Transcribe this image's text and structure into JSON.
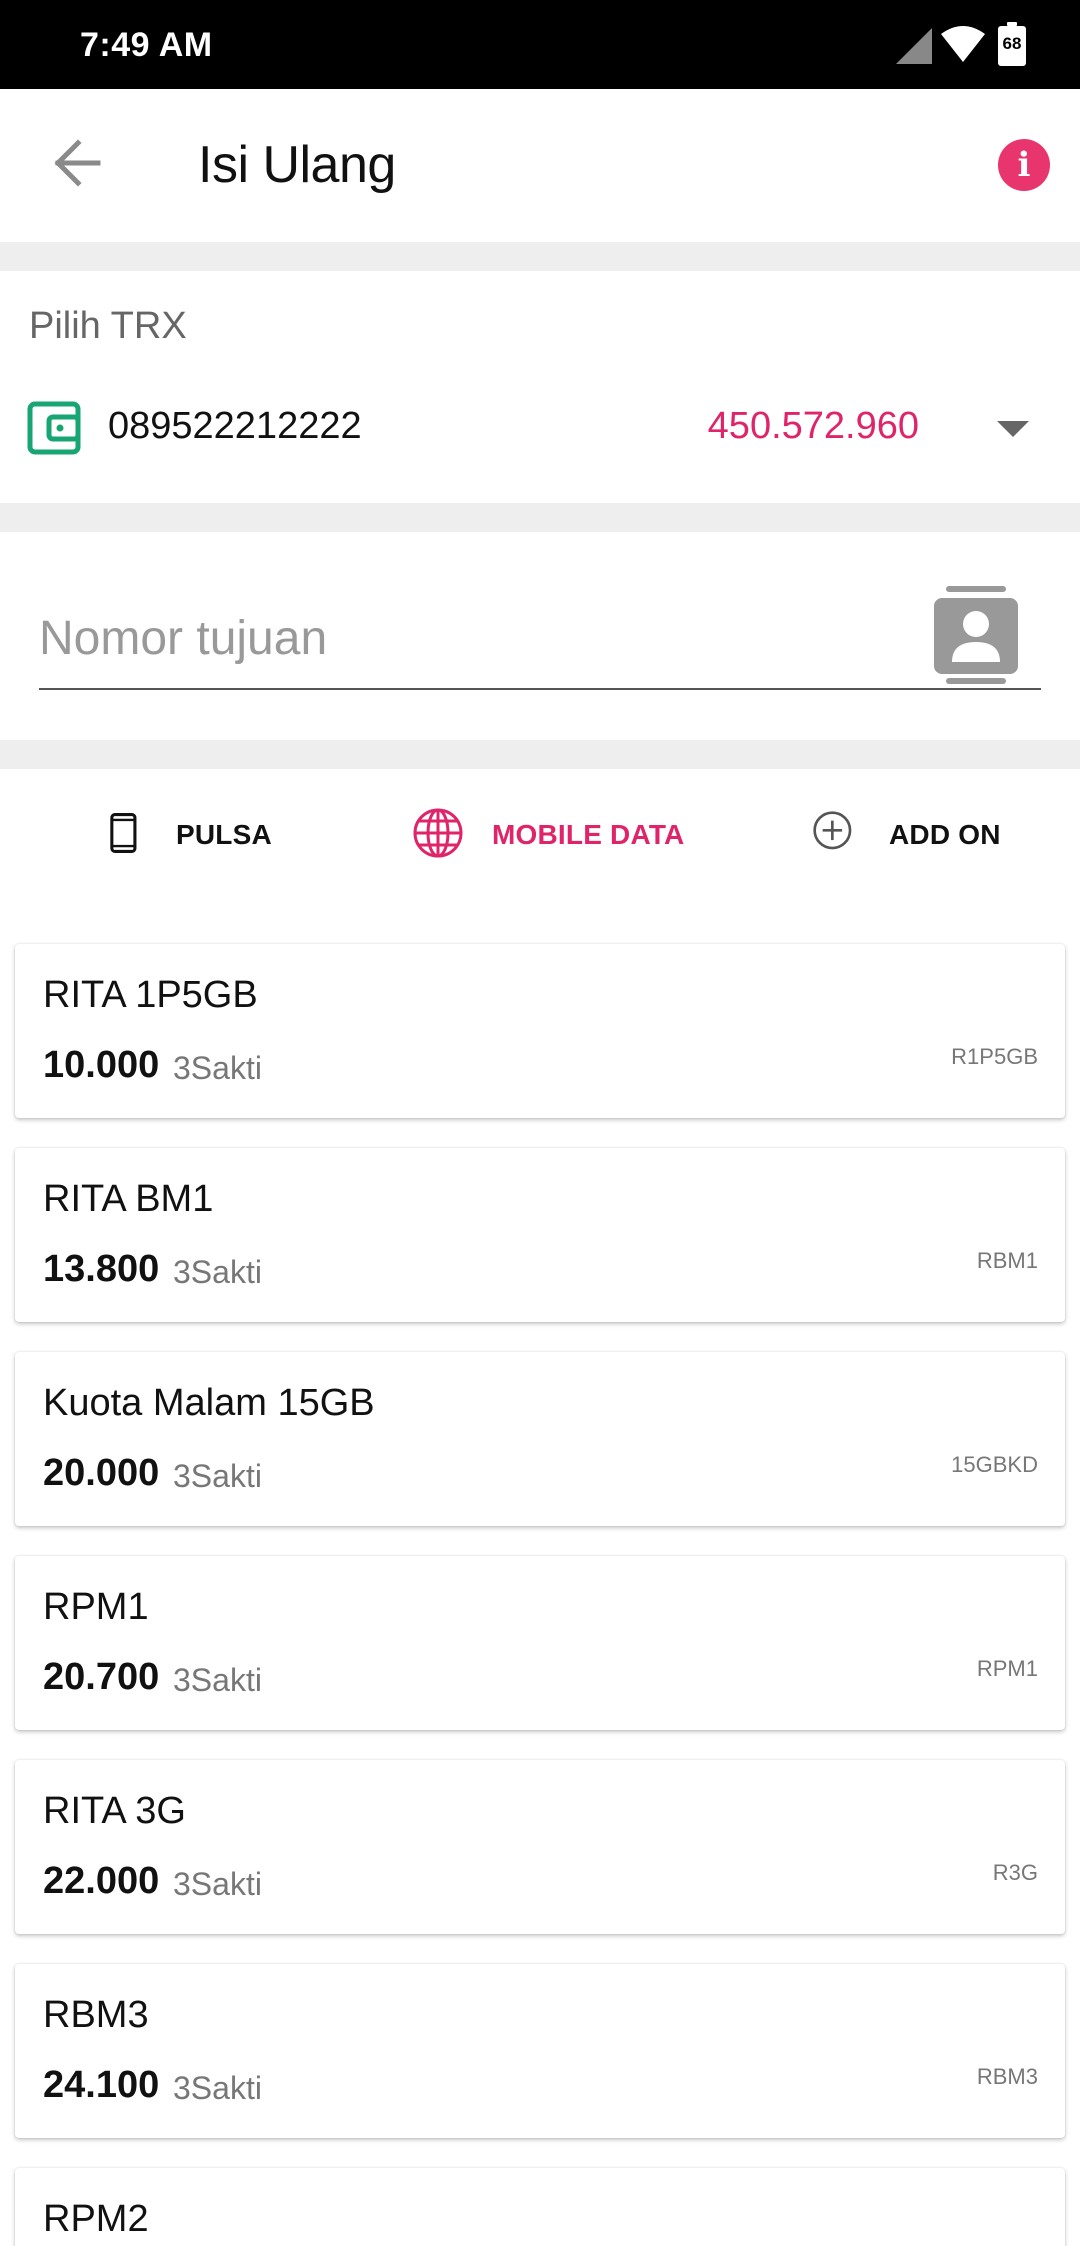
{
  "status_bar": {
    "time": "7:49 AM",
    "battery": "68",
    "icons": [
      "signal-icon",
      "wifi-icon",
      "battery-icon"
    ]
  },
  "header": {
    "title": "Isi Ulang",
    "back_icon": "arrow-left-icon",
    "info_label": "i"
  },
  "trx": {
    "label": "Pilih TRX",
    "number": "089522212222",
    "balance": "450.572.960"
  },
  "target": {
    "placeholder": "Nomor tujuan",
    "value": ""
  },
  "tabs": [
    {
      "label": "PULSA",
      "icon": "phone-icon",
      "active": false
    },
    {
      "label": "MOBILE DATA",
      "icon": "globe-icon",
      "active": true
    },
    {
      "label": "ADD ON",
      "icon": "plus-circle-icon",
      "active": false
    }
  ],
  "products": [
    {
      "name": "RITA 1P5GB",
      "price": "10.000",
      "provider": "3Sakti",
      "code": "R1P5GB"
    },
    {
      "name": "RITA BM1",
      "price": "13.800",
      "provider": "3Sakti",
      "code": "RBM1"
    },
    {
      "name": "Kuota Malam 15GB",
      "price": "20.000",
      "provider": "3Sakti",
      "code": "15GBKD"
    },
    {
      "name": "RPM1",
      "price": "20.700",
      "provider": "3Sakti",
      "code": "RPM1"
    },
    {
      "name": "RITA 3G",
      "price": "22.000",
      "provider": "3Sakti",
      "code": "R3G"
    },
    {
      "name": "RBM3",
      "price": "24.100",
      "provider": "3Sakti",
      "code": "RBM3"
    },
    {
      "name": "RPM2",
      "price": "",
      "provider": "",
      "code": ""
    }
  ],
  "colors": {
    "accent": "#e0246a",
    "info": "#e8356e",
    "wallet": "#17a673",
    "inactive_tab": "#111111"
  }
}
